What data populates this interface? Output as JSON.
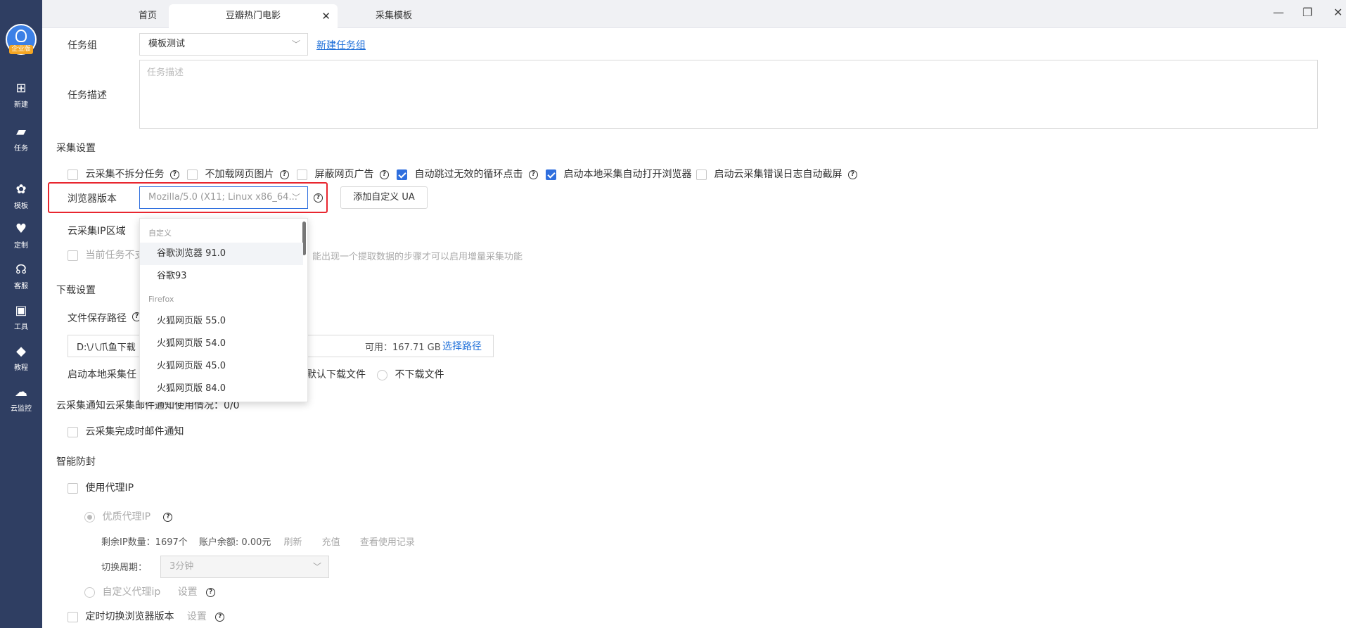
{
  "sidebar": {
    "badge": "企业版",
    "items": [
      {
        "label": "新建",
        "icon": "plus-square-icon"
      },
      {
        "label": "任务",
        "icon": "bookmark-icon"
      },
      {
        "label": "模板",
        "icon": "template-icon"
      },
      {
        "label": "定制",
        "icon": "heart-check-icon"
      },
      {
        "label": "客服",
        "icon": "headset-icon"
      },
      {
        "label": "工具",
        "icon": "toolbox-icon"
      },
      {
        "label": "教程",
        "icon": "graduation-cap-icon"
      },
      {
        "label": "云监控",
        "icon": "cloud-monitor-icon"
      }
    ]
  },
  "tabs": [
    {
      "label": "首页"
    },
    {
      "label": "豆瓣热门电影"
    },
    {
      "label": "采集模板"
    }
  ],
  "form": {
    "task_group_label": "任务组",
    "task_group_value": "模板测试",
    "new_task_group": "新建任务组",
    "task_desc_label": "任务描述",
    "task_desc_placeholder": "任务描述",
    "collect_settings": "采集设置",
    "opt_cloud_nosplit": "云采集不拆分任务",
    "opt_noimg": "不加载网页图片",
    "opt_block_ads": "屏蔽网页广告",
    "opt_skip_loop": "自动跳过无效的循环点击",
    "opt_open_browser": "启动本地采集自动打开浏览器",
    "opt_err_screenshot": "启动云采集错误日志自动截屏",
    "browser_version_label": "浏览器版本",
    "browser_version_value": "Mozilla/5.0 (X11; Linux x86_64...",
    "add_ua_button": "添加自定义 UA",
    "cloud_ip_label": "云采集IP区域",
    "incremental_prefix": "当前任务不支",
    "incremental_suffix": "能出现一个提取数据的步骤才可以启用增量采集功能",
    "download_settings": "下载设置",
    "save_path_label": "文件保存路径",
    "save_path_value": "D:\\八爪鱼下载",
    "available_space": "可用：167.71 GB",
    "choose_path": "选择路径",
    "local_start_label": "启动本地采集任",
    "default_download": "默认下载文件",
    "no_download": "不下载文件",
    "cloud_notice_label": "云采集通知云采集邮件通知使用情况：0/0",
    "cloud_mail_notice": "云采集完成时邮件通知",
    "anti_block": "智能防封",
    "use_proxy": "使用代理IP",
    "quality_proxy": "优质代理IP",
    "remaining_ip": "剩余IP数量：1697个",
    "balance": "账户余额: 0.00元",
    "refresh": "刷新",
    "recharge": "充值",
    "usage_record": "查看使用记录",
    "switch_period_label": "切换周期：",
    "switch_period_value": "3分钟",
    "custom_proxy": "自定义代理ip",
    "settings": "设置",
    "timed_switch_browser": "定时切换浏览器版本"
  },
  "dropdown": {
    "group_custom": "自定义",
    "group_firefox": "Firefox",
    "items_custom": [
      "谷歌浏览器 91.0",
      "谷歌93"
    ],
    "items_firefox": [
      "火狐网页版 55.0",
      "火狐网页版 54.0",
      "火狐网页版 45.0",
      "火狐网页版 84.0"
    ]
  },
  "colors": {
    "sidebar": "#2f3e62",
    "accent": "#2f6fde",
    "highlight_box": "#e8262f"
  }
}
